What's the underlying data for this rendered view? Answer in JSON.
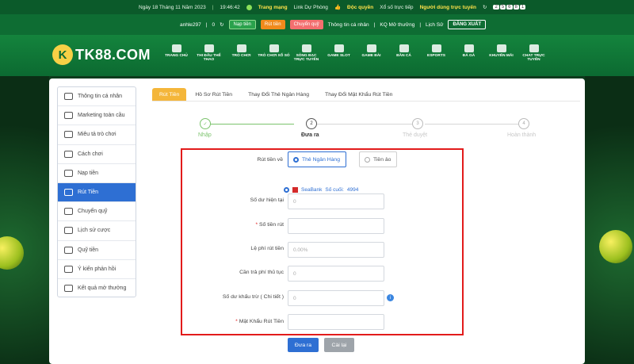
{
  "topbar": {
    "date": "Ngày 18 Tháng 11 Năm 2023",
    "time": "19:46:42",
    "network": "Trang mạng",
    "link": "Link Dự Phòng",
    "exclusive": "Độc quyền",
    "lottery": "Xổ số trực tiếp",
    "online_label": "Người dùng trực tuyến",
    "online_count": [
      "2",
      "5",
      "6",
      "8",
      "1"
    ]
  },
  "userbar": {
    "username": "anhle297",
    "balance": "0",
    "deposit": "Nạp tiền",
    "withdraw": "Rút tiền",
    "transfer": "Chuyển quỹ",
    "personal_info": "Thông tin cá nhân",
    "result": "KQ Mở thưởng",
    "history": "Lịch Sử",
    "logout": "ĐĂNG XUẤT"
  },
  "logo": {
    "mark": "K",
    "text": "TK88.COM"
  },
  "nav": [
    "TRANG CHỦ",
    "THI ĐẤU THỂ THAO",
    "TRÒ CHƠI",
    "TRÒ CHƠI XỔ SỐ",
    "SÒNG BẠC TRỰC TUYẾN",
    "GAME SLOT",
    "GAME BÀI",
    "BẮN CÁ",
    "ESPORTS",
    "ĐÁ GÀ",
    "KHUYẾN MÃI",
    "CHAT TRỰC TUYẾN"
  ],
  "sidebar": [
    "Thông tin cá nhân",
    "Marketing toàn cầu",
    "Miêu tả trò chơi",
    "Cách chơi",
    "Nạp tiền",
    "Rút Tiền",
    "Chuyển quỹ",
    "Lịch sử cược",
    "Quỹ tiền",
    "Ý kiến phản hồi",
    "Kết quả mở thưởng"
  ],
  "tabs": [
    "Rút Tiền",
    "Hồ Sơ Rút Tiền",
    "Thay Đổi Thẻ Ngân Hàng",
    "Thay Đổi Mật Khẩu Rút Tiền"
  ],
  "steps": [
    {
      "num": "✓",
      "label": "Nhập"
    },
    {
      "num": "2",
      "label": "Đưa ra"
    },
    {
      "num": "3",
      "label": "Thẻ duyệt"
    },
    {
      "num": "4",
      "label": "Hoàn thành"
    }
  ],
  "form": {
    "withdraw_to_label": "Rút tiền về",
    "option_bank": "Thẻ Ngân Hàng",
    "option_virtual": "Tiền ảo",
    "bank_name": "SeaBank",
    "card_label": "Số cuối:",
    "card_last": "4994",
    "balance_label": "Số dư hiện tại",
    "balance_value": "0",
    "amount_label": "Số tiền rút",
    "fee_label": "Lệ phí rút tiền",
    "fee_value": "0.00%",
    "needpay_label": "Cần trả phí thủ tục",
    "needpay_value": "0",
    "deduct_label": "Số dư khấu trừ ( Chi tiết )",
    "deduct_value": "0",
    "password_label": "Mật Khẩu Rút Tiền",
    "required_mark": "*"
  },
  "buttons": {
    "submit": "Đưa ra",
    "reset": "Cài lại"
  }
}
